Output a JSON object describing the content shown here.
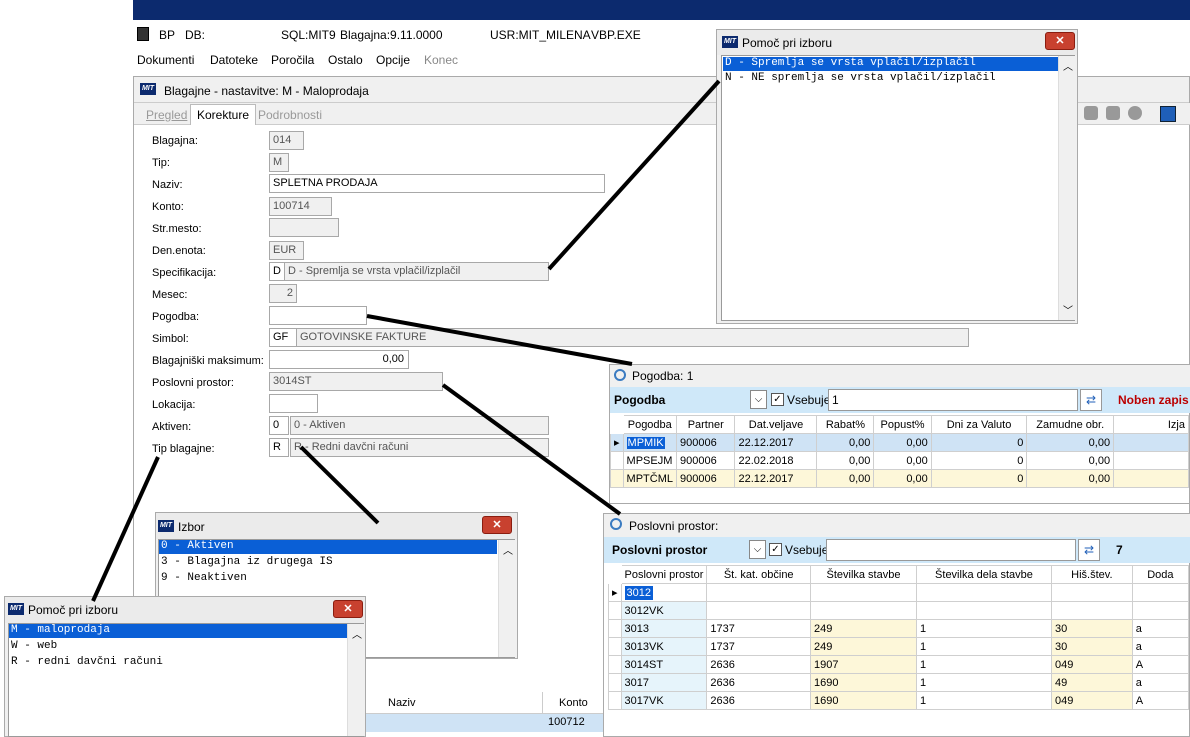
{
  "appbar": {
    "bp": "BP",
    "db": "DB:",
    "sql": "SQL:MIT9",
    "blagajna": "Blagajna:9.11.0000",
    "usr": "USR:MIT_MILENA",
    "exe": "VBP.EXE"
  },
  "menu": [
    "Dokumenti",
    "Datoteke",
    "Poročila",
    "Ostalo",
    "Opcije",
    "Konec"
  ],
  "main": {
    "title": "Blagajne - nastavitve: M - Maloprodaja",
    "tabs": [
      "Pregled",
      "Korekture",
      "Podrobnosti"
    ],
    "labels": [
      "Blagajna:",
      "Tip:",
      "Naziv:",
      "Konto:",
      "Str.mesto:",
      "Den.enota:",
      "Specifikacija:",
      "Mesec:",
      "Pogodba:",
      "Simbol:",
      "Blagajniški maksimum:",
      "Poslovni prostor:",
      "Lokacija:",
      "Aktiven:",
      "Tip blagajne:"
    ],
    "blagajna": "014",
    "tip": "M",
    "naziv": "SPLETNA PRODAJA",
    "konto": "100714",
    "str_mesto": "",
    "den_enota": "EUR",
    "spec_code": "D",
    "spec_desc": "D - Spremlja se vrsta vplačil/izplačil",
    "mesec": "2",
    "pogodba": "",
    "simbol_code": "GF",
    "simbol_desc": "GOTOVINSKE FAKTURE",
    "maksimum": "0,00",
    "poslovni_prostor": "3014ST",
    "lokacija": "",
    "aktiven_code": "0",
    "aktiven_desc": "0 - Aktiven",
    "tip_code": "R",
    "tip_desc": "R - Redni davčni računi"
  },
  "help_top": {
    "title": "Pomoč pri izboru",
    "close": "✕",
    "items": [
      "D - Spremlja se vrsta vplačil/izplačil",
      "N - NE spremlja se vrsta vplačil/izplačil"
    ]
  },
  "pogodba": {
    "title": "Pogodba:  1",
    "filter_label": "Pogodba",
    "vsebuje": "Vsebuje",
    "filter_value": "1",
    "status": "Noben zapis",
    "columns": [
      "Pogodba",
      "Partner",
      "Dat.veljave",
      "Rabat%",
      "Popust%",
      "Dni za Valuto",
      "Zamudne obr.",
      "Izja"
    ],
    "rows": [
      [
        "MPMIK",
        "900006",
        "22.12.2017",
        "0,00",
        "0,00",
        "0",
        "0,00",
        ""
      ],
      [
        "MPSEJM",
        "900006",
        "22.02.2018",
        "0,00",
        "0,00",
        "0",
        "0,00",
        ""
      ],
      [
        "MPTČML",
        "900006",
        "22.12.2017",
        "0,00",
        "0,00",
        "0",
        "0,00",
        ""
      ]
    ]
  },
  "poslovni": {
    "title": "Poslovni prostor:",
    "filter_label": "Poslovni prostor",
    "vsebuje": "Vsebuje",
    "count": "7",
    "columns": [
      "Poslovni prostor",
      "Št. kat. občine",
      "Številka stavbe",
      "Številka dela stavbe",
      "Hiš.štev.",
      "Doda"
    ],
    "rows": [
      [
        "3012",
        "",
        "",
        "",
        "",
        ""
      ],
      [
        "3012VK",
        "",
        "",
        "",
        "",
        ""
      ],
      [
        "3013",
        "1737",
        "249",
        "1",
        "30",
        "a"
      ],
      [
        "3013VK",
        "1737",
        "249",
        "1",
        "30",
        "a"
      ],
      [
        "3014ST",
        "2636",
        "1907",
        "1",
        "049",
        "A"
      ],
      [
        "3017",
        "2636",
        "1690",
        "1",
        "49",
        "a"
      ],
      [
        "3017VK",
        "2636",
        "1690",
        "1",
        "049",
        "A"
      ]
    ]
  },
  "izbor": {
    "title": "Izbor",
    "close": "✕",
    "items": [
      "0 - Aktiven",
      "3 - Blagajna iz drugega IS",
      "9 - Neaktiven"
    ]
  },
  "help_bottom": {
    "title": "Pomoč pri izboru",
    "close": "✕",
    "items": [
      "M - maloprodaja",
      "W - web",
      "R - redni davčni računi"
    ]
  },
  "bottom_table": {
    "naziv": "Naziv",
    "konto": "Konto",
    "konto_val": "100712"
  }
}
